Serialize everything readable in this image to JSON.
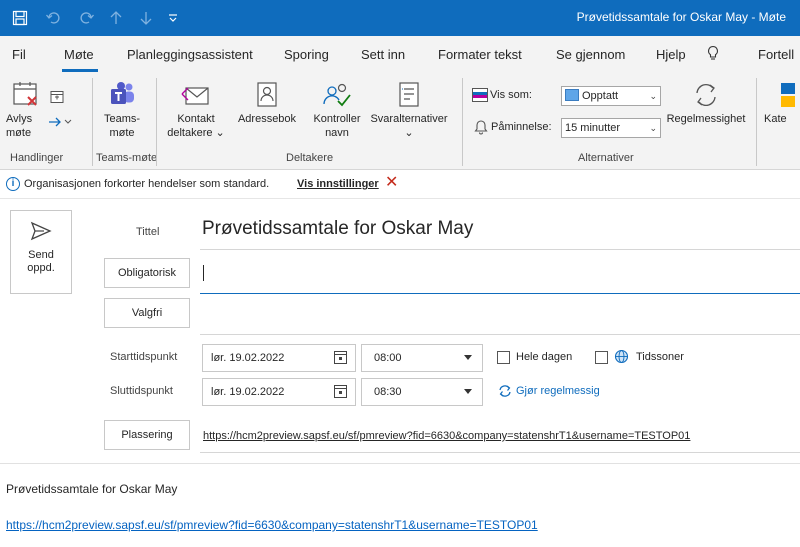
{
  "window": {
    "title": "Prøvetidssamtale for Oskar May  -  Møte",
    "quick_access": [
      "save-icon",
      "undo-icon",
      "redo-icon",
      "up-arrow-icon",
      "down-arrow-icon",
      "customize-icon"
    ]
  },
  "tabs": [
    "Fil",
    "Møte",
    "Planleggingsassistent",
    "Sporing",
    "Sett inn",
    "Formater tekst",
    "Se gjennom",
    "Hjelp",
    "Fortell"
  ],
  "active_tab": "Møte",
  "ribbon": {
    "avlys_1": "Avlys",
    "avlys_2": "møte",
    "teams_1": "Teams-",
    "teams_2": "møte",
    "kontakt_1": "Kontakt",
    "kontakt_2": "deltakere",
    "adressebok": "Adressebok",
    "kontroller_1": "Kontroller",
    "kontroller_2": "navn",
    "svar": "Svaralternativer",
    "vis_som_label": "Vis som:",
    "vis_som_value": "Opptatt",
    "paaminnelse_label": "Påminnelse:",
    "paaminnelse_value": "15 minutter",
    "regelmessighet": "Regelmessighet",
    "kategori": "Kate",
    "group_handlinger": "Handlinger",
    "group_teams": "Teams-møte",
    "group_deltakere": "Deltakere",
    "group_alternativer": "Alternativer",
    "accent_color": "#0f6cbd"
  },
  "infobar": {
    "text": "Organisasjonen forkorter hendelser som standard.",
    "link": "Vis innstillinger",
    "close": "✕"
  },
  "send": {
    "line1": "Send",
    "line2": "oppd."
  },
  "form": {
    "tittel_label": "Tittel",
    "tittel_value": "Prøvetidssamtale for Oskar May",
    "obligatorisk": "Obligatorisk",
    "valgfri": "Valgfri",
    "start_label": "Starttidspunkt",
    "start_date": "lør. 19.02.2022",
    "start_time": "08:00",
    "end_label": "Sluttidspunkt",
    "end_date": "lør. 19.02.2022",
    "end_time": "08:30",
    "hele_dagen": "Hele dagen",
    "tidssoner": "Tidssoner",
    "regelmessig": "Gjør regelmessig",
    "plassering": "Plassering",
    "location_value": "https://hcm2preview.sapsf.eu/sf/pmreview?fid=6630&company=statenshrT1&username=TESTOP01"
  },
  "body": {
    "text": "Prøvetidssamtale for Oskar May",
    "link": "https://hcm2preview.sapsf.eu/sf/pmreview?fid=6630&company=statenshrT1&username=TESTOP01"
  }
}
